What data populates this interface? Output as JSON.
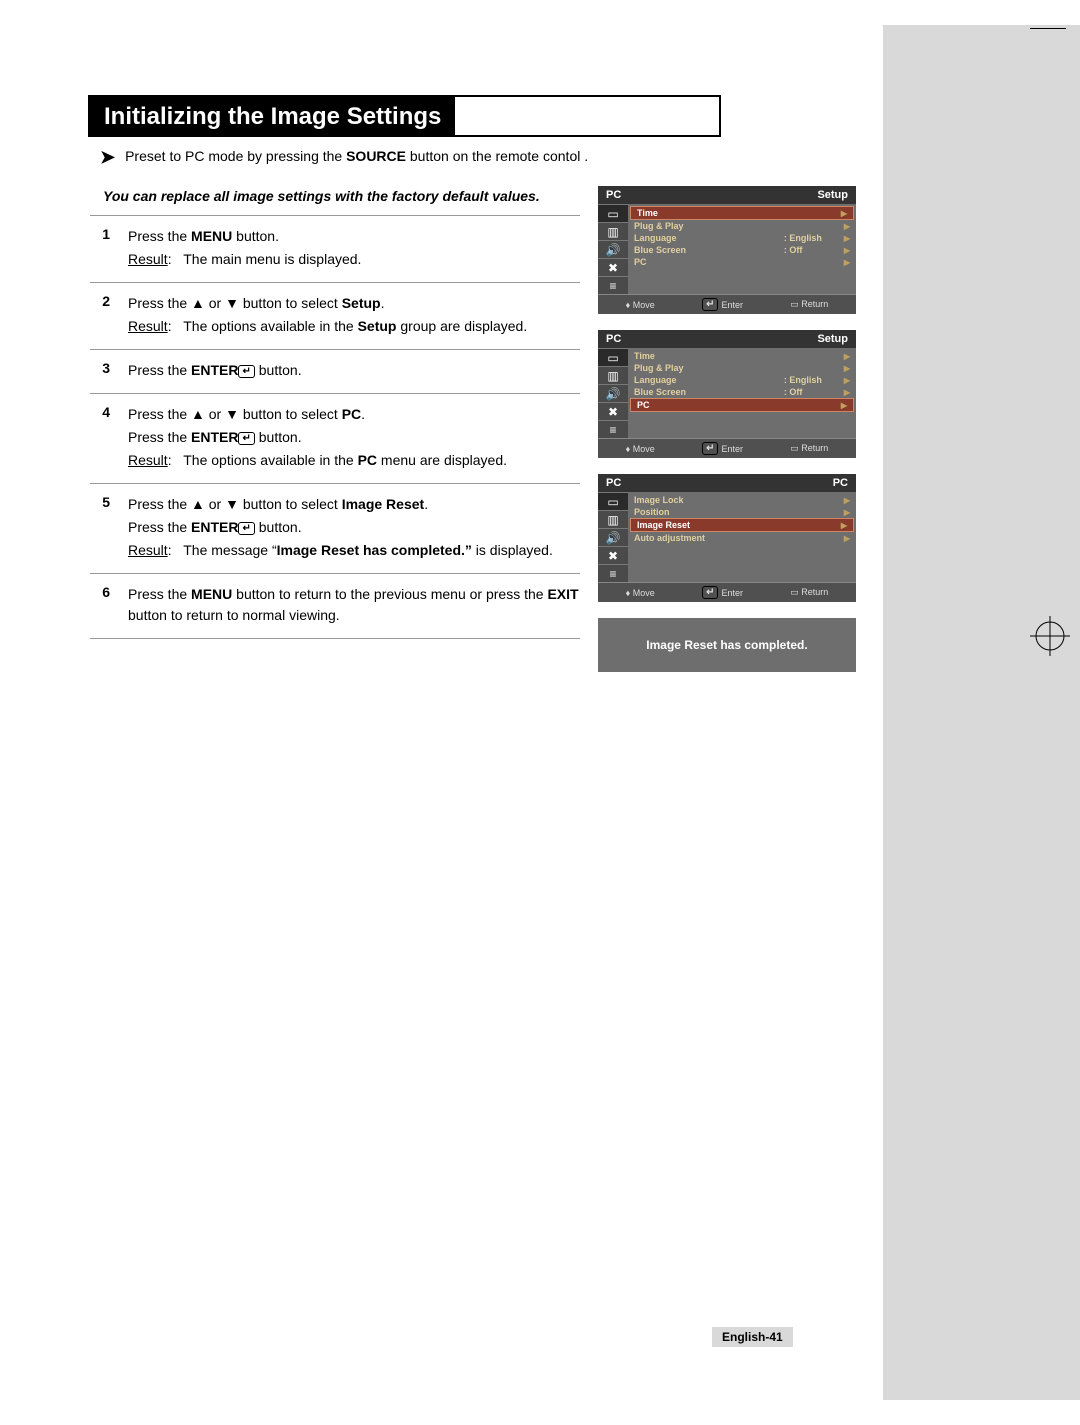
{
  "title": "Initializing the Image Settings",
  "note": {
    "pre": "Preset to PC mode by pressing the ",
    "strong": "SOURCE",
    "post": " button on the remote contol ."
  },
  "intro": "You can replace all image settings with the factory default values.",
  "steps": [
    {
      "n": "1",
      "lines": [
        {
          "t": "plain-strong",
          "pre": "Press the ",
          "strong": "MENU",
          "post": " button."
        },
        {
          "t": "result",
          "text": "The main menu is displayed."
        }
      ]
    },
    {
      "n": "2",
      "lines": [
        {
          "t": "arrows-strong",
          "pre": "Press the ",
          "mid": " button to select ",
          "strong": "Setup",
          "post": "."
        },
        {
          "t": "result-strong",
          "pre": "The options available in the ",
          "strong": "Setup",
          "post": " group are displayed."
        }
      ]
    },
    {
      "n": "3",
      "lines": [
        {
          "t": "enter",
          "pre": "Press the ",
          "strong": "ENTER",
          "post": " button."
        }
      ]
    },
    {
      "n": "4",
      "lines": [
        {
          "t": "arrows-strong",
          "pre": "Press the ",
          "mid": " button to select ",
          "strong": "PC",
          "post": "."
        },
        {
          "t": "enter",
          "pre": "Press the ",
          "strong": "ENTER",
          "post": " button."
        },
        {
          "t": "result-strong",
          "pre": "The options available in the ",
          "strong": "PC",
          "post": " menu are displayed."
        }
      ]
    },
    {
      "n": "5",
      "lines": [
        {
          "t": "arrows-strong",
          "pre": "Press the ",
          "mid": " button to select ",
          "strong": "Image Reset",
          "post": "."
        },
        {
          "t": "enter",
          "pre": "Press the ",
          "strong": "ENTER",
          "post": " button."
        },
        {
          "t": "result-quote",
          "pre": "The message “",
          "strong": "Image Reset has completed.”",
          "post": " is displayed."
        }
      ]
    },
    {
      "n": "6",
      "lines": [
        {
          "t": "two-strong",
          "pre": "Press the ",
          "s1": "MENU",
          "mid": " button to return to the previous menu or press the ",
          "s2": "EXIT",
          "post": " button to return to normal viewing."
        }
      ]
    }
  ],
  "osd": {
    "foot": {
      "move": "Move",
      "enter": "Enter",
      "return": "Return"
    },
    "screens": [
      {
        "left": "PC",
        "right": "Setup",
        "rows": [
          {
            "label": "Time",
            "value": "",
            "sel": true
          },
          {
            "label": "Plug & Play",
            "value": ""
          },
          {
            "label": "Language",
            "value": ":   English"
          },
          {
            "label": "Blue Screen",
            "value": ":   Off"
          },
          {
            "label": "PC",
            "value": ""
          }
        ]
      },
      {
        "left": "PC",
        "right": "Setup",
        "rows": [
          {
            "label": "Time",
            "value": ""
          },
          {
            "label": "Plug & Play",
            "value": ""
          },
          {
            "label": "Language",
            "value": ":   English"
          },
          {
            "label": "Blue Screen",
            "value": ":   Off"
          },
          {
            "label": "PC",
            "value": "",
            "sel": true
          }
        ]
      },
      {
        "left": "PC",
        "right": "PC",
        "rows": [
          {
            "label": "Image Lock",
            "value": ""
          },
          {
            "label": "Position",
            "value": ""
          },
          {
            "label": "Image Reset",
            "value": "",
            "sel": true
          },
          {
            "label": "Auto adjustment",
            "value": ""
          }
        ]
      }
    ],
    "message": "Image Reset has completed."
  },
  "pageNumber": "English-41"
}
